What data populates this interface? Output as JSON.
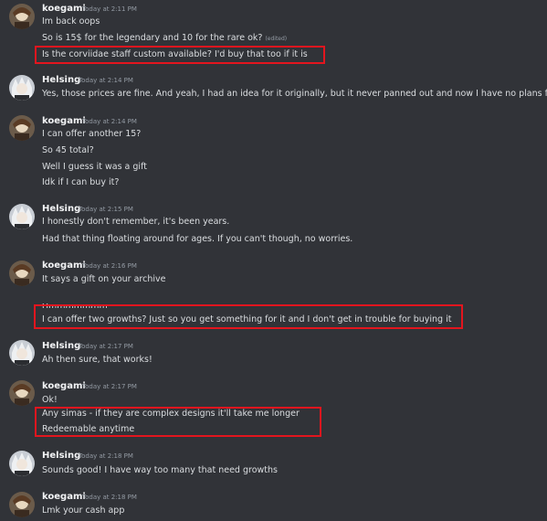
{
  "messages": [
    {
      "author": "koegami",
      "ts": "Today at 2:11 PM",
      "lines": [
        "Im back oops",
        "So is 15$ for the legendary and 10 for the rare ok?",
        "Is the corviidae staff custom available? I'd buy that too if it is"
      ],
      "edited_tag": "(edited)"
    },
    {
      "author": "Helsing",
      "ts": "Today at 2:14 PM",
      "lines": [
        "Yes, those prices are fine. And yeah, I had an idea for it originally, but it never panned out and now I have no plans for it"
      ]
    },
    {
      "author": "koegami",
      "ts": "Today at 2:14 PM",
      "lines": [
        "I can offer another 15?",
        "So 45 total?",
        "Well I guess it was a gift",
        "Idk if I can buy it?"
      ]
    },
    {
      "author": "Helsing",
      "ts": "Today at 2:15 PM",
      "lines": [
        "I honestly don't remember, it's been years.",
        "Had that thing floating around for ages. If you can't though, no worries."
      ]
    },
    {
      "author": "koegami",
      "ts": "Today at 2:16 PM",
      "lines": [
        "It says a gift on your archive",
        "Ummmmmmm",
        "I can offer two growths? Just so you get something for it and I don't get in trouble for buying it"
      ]
    },
    {
      "author": "Helsing",
      "ts": "Today at 2:17 PM",
      "lines": [
        "Ah then sure, that works!"
      ]
    },
    {
      "author": "koegami",
      "ts": "Today at 2:17 PM",
      "lines": [
        "Ok!",
        "Any simas - if they are complex designs it'll take me longer",
        "Redeemable anytime"
      ]
    },
    {
      "author": "Helsing",
      "ts": "Today at 2:18 PM",
      "lines": [
        "Sounds good! I have way too many that need growths"
      ]
    },
    {
      "author": "koegami",
      "ts": "Today at 2:18 PM",
      "lines": [
        "Lmk your cash app"
      ]
    }
  ],
  "colors": {
    "background": "#313338",
    "highlight": "#e3151e",
    "author": "#f2f3f5",
    "timestamp": "#949ba4",
    "text": "#dbdee1"
  },
  "avatars": {
    "koegami": "koegami-avatar-icon",
    "Helsing": "helsing-avatar-icon"
  }
}
